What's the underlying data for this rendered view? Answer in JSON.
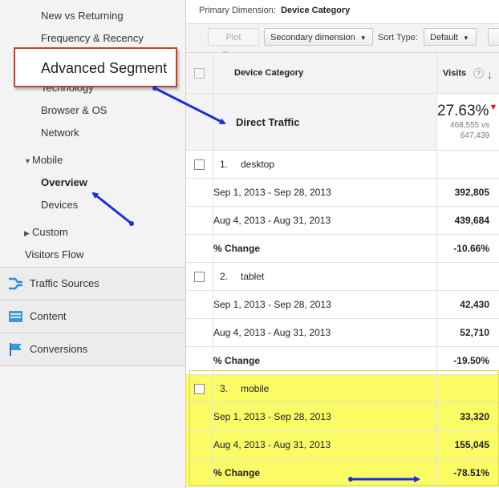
{
  "sidebar": {
    "items": [
      {
        "label": "New vs Returning"
      },
      {
        "label": "Frequency & Recency"
      },
      {
        "label": "Technology"
      },
      {
        "label": "Browser & OS"
      },
      {
        "label": "Network"
      },
      {
        "label": "Mobile"
      },
      {
        "label": "Overview"
      },
      {
        "label": "Devices"
      },
      {
        "label": "Custom"
      },
      {
        "label": "Visitors Flow"
      }
    ],
    "sections": [
      {
        "label": "Traffic Sources",
        "icon": "traffic-sources-icon"
      },
      {
        "label": "Content",
        "icon": "content-icon"
      },
      {
        "label": "Conversions",
        "icon": "conversions-icon"
      }
    ]
  },
  "callout": {
    "label": "Advanced Segment"
  },
  "report": {
    "primary_dimension_label": "Primary Dimension:",
    "primary_dimension_value": "Device Category",
    "toolbar": {
      "plot_rows": "Plot Rows",
      "secondary_dimension": "Secondary dimension",
      "sort_type_label": "Sort Type:",
      "sort_type_value": "Default"
    },
    "table": {
      "header_dimension": "Device Category",
      "header_metric": "Visits",
      "summary": {
        "label": "Direct Traffic",
        "percent": "27.63%",
        "of_line1": "468,555 vs",
        "of_line2": "647,439"
      },
      "groups": [
        {
          "num": "1.",
          "name": "desktop",
          "rows": [
            {
              "label": "Sep 1, 2013 - Sep 28, 2013",
              "value": "392,805"
            },
            {
              "label": "Aug 4, 2013 - Aug 31, 2013",
              "value": "439,684"
            },
            {
              "label": "% Change",
              "value": "-10.66%"
            }
          ]
        },
        {
          "num": "2.",
          "name": "tablet",
          "rows": [
            {
              "label": "Sep 1, 2013 - Sep 28, 2013",
              "value": "42,430"
            },
            {
              "label": "Aug 4, 2013 - Aug 31, 2013",
              "value": "52,710"
            },
            {
              "label": "% Change",
              "value": "-19.50%"
            }
          ]
        },
        {
          "num": "3.",
          "name": "mobile",
          "rows": [
            {
              "label": "Sep 1, 2013 - Sep 28, 2013",
              "value": "33,320"
            },
            {
              "label": "Aug 4, 2013 - Aug 31, 2013",
              "value": "155,045"
            },
            {
              "label": "% Change",
              "value": "-78.51%"
            }
          ]
        }
      ]
    }
  },
  "colors": {
    "annotation_arrow": "#1c2fd6",
    "callout_border": "#b44a31",
    "highlight": "#fbfb66",
    "down_arrow": "#e02020"
  }
}
